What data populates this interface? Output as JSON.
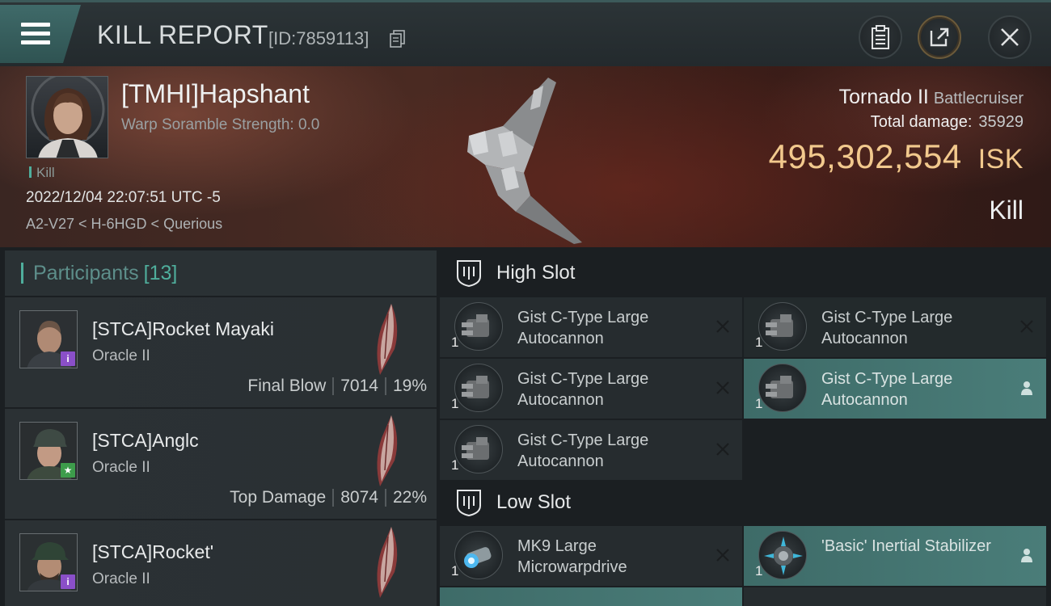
{
  "header": {
    "title": "KILL REPORT",
    "report_id": "[ID:7859113]",
    "icons": [
      "menu-icon",
      "copy-icon",
      "clipboard-icon",
      "share-icon",
      "close-icon"
    ]
  },
  "victim": {
    "name": "[TMHI]Hapshant",
    "warp_scramble": "Warp Soramble Strength: 0.0",
    "tag": "Kill",
    "datetime": "2022/12/04 22:07:51 UTC -5",
    "location": "A2-V27 < H-6HGD < Querious",
    "ship_name": "Tornado II",
    "ship_class": "Battlecruiser",
    "total_damage_label": "Total damage:",
    "total_damage": "35929",
    "isk_value": "495,302,554",
    "isk_unit": "ISK",
    "result": "Kill"
  },
  "participants": {
    "label": "Participants",
    "count": "[13]",
    "rows": [
      {
        "name": "[STCA]Rocket Mayaki",
        "ship": "Oracle II",
        "role": "Final Blow",
        "damage": "7014",
        "percent": "19%",
        "badge": "i"
      },
      {
        "name": "[STCA]Anglc",
        "ship": "Oracle II",
        "role": "Top Damage",
        "damage": "8074",
        "percent": "22%",
        "badge": "★"
      },
      {
        "name": "[STCA]Rocket'",
        "ship": "Oracle II",
        "role": "",
        "damage": "",
        "percent": "",
        "badge": "i"
      }
    ]
  },
  "fitting": {
    "high_slot_label": "High Slot",
    "low_slot_label": "Low Slot",
    "high": [
      {
        "name": "Gist C-Type Large Autocannon",
        "qty": "1",
        "state": "destroyed"
      },
      {
        "name": "Gist C-Type Large Autocannon",
        "qty": "1",
        "state": "destroyed"
      },
      {
        "name": "Gist C-Type Large Autocannon",
        "qty": "1",
        "state": "destroyed"
      },
      {
        "name": "Gist C-Type Large Autocannon",
        "qty": "1",
        "state": "dropped"
      },
      {
        "name": "Gist C-Type Large Autocannon",
        "qty": "1",
        "state": "destroyed"
      }
    ],
    "low": [
      {
        "name": "MK9 Large Microwarpdrive",
        "qty": "1",
        "state": "destroyed"
      },
      {
        "name": "'Basic' Inertial Stabilizer",
        "qty": "1",
        "state": "dropped"
      }
    ]
  },
  "colors": {
    "accent": "#4fae9c",
    "isk": "#f2c98d",
    "dropped_bg": "#447874",
    "badge_purple": "#8a4fc8",
    "badge_green": "#3d9c4b"
  }
}
